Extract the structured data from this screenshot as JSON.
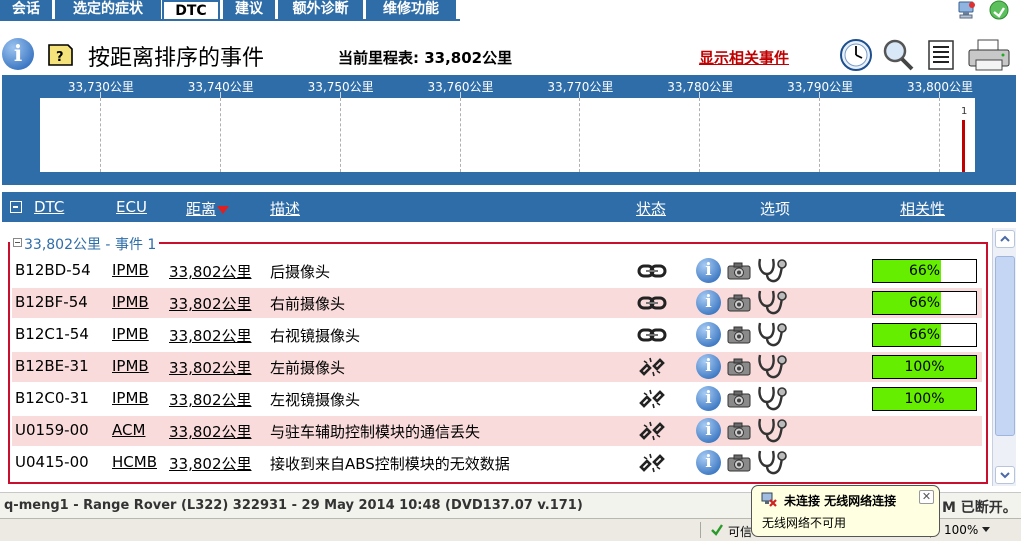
{
  "tabs": [
    {
      "label": "会话",
      "active": false
    },
    {
      "label": "选定的症状",
      "active": false
    },
    {
      "label": "DTC",
      "active": true
    },
    {
      "label": "建议",
      "active": false
    },
    {
      "label": "额外诊断",
      "active": false
    },
    {
      "label": "维修功能",
      "active": false
    }
  ],
  "header": {
    "title": "按距离排序的事件",
    "odometer": "当前里程表: 33,802公里",
    "show_related": "显示相关事件"
  },
  "timeline": {
    "labels": [
      "33,730公里",
      "33,740公里",
      "33,750公里",
      "33,760公里",
      "33,770公里",
      "33,780公里",
      "33,790公里",
      "33,800公里"
    ],
    "event_count_label": "1",
    "range": [
      33725,
      33803
    ],
    "event_at": 33802
  },
  "columns": {
    "dtc": "DTC",
    "ecu": "ECU",
    "distance": "距离",
    "description": "描述",
    "status": "状态",
    "options": "选项",
    "relevance": "相关性"
  },
  "group": {
    "legend": "33,802公里 - 事件 1"
  },
  "rows": [
    {
      "dtc": "B12BD-54",
      "ecu": "IPMB",
      "distance": "33,802公里",
      "description": "后摄像头",
      "status": "connected",
      "relevance": "66%",
      "relevance_value": 0.66
    },
    {
      "dtc": "B12BF-54",
      "ecu": "IPMB",
      "distance": "33,802公里",
      "description": "右前摄像头",
      "status": "connected",
      "relevance": "66%",
      "relevance_value": 0.66
    },
    {
      "dtc": "B12C1-54",
      "ecu": "IPMB",
      "distance": "33,802公里",
      "description": "右视镜摄像头",
      "status": "connected",
      "relevance": "66%",
      "relevance_value": 0.66
    },
    {
      "dtc": "B12BE-31",
      "ecu": "IPMB",
      "distance": "33,802公里",
      "description": "左前摄像头",
      "status": "broken",
      "relevance": "100%",
      "relevance_value": 1.0
    },
    {
      "dtc": "B12C0-31",
      "ecu": "IPMB",
      "distance": "33,802公里",
      "description": "左视镜摄像头",
      "status": "broken",
      "relevance": "100%",
      "relevance_value": 1.0
    },
    {
      "dtc": "U0159-00",
      "ecu": "ACM",
      "distance": "33,802公里",
      "description": "与驻车辅助控制模块的通信丢失",
      "status": "broken",
      "relevance": "",
      "relevance_value": null
    },
    {
      "dtc": "U0415-00",
      "ecu": "HCMB",
      "distance": "33,802公里",
      "description": "接收到来自ABS控制模块的无效数据",
      "status": "broken",
      "relevance": "",
      "relevance_value": null
    }
  ],
  "status_bar": {
    "session": "q-meng1 - Range Rover (L322) 322931 - 29 May 2014 10:48 (DVD137.07 v.171)",
    "right": "M 已断开。"
  },
  "ie_status": {
    "trusted": "可信",
    "zoom": "100%"
  },
  "balloon": {
    "title": "未连接  无线网络连接",
    "body": "无线网络不可用",
    "close": "✕"
  },
  "colors": {
    "header_blue": "#2f6da8",
    "alt_row": "#fadbdb",
    "group_border": "#c8102e",
    "relevance_fill": "#66ee00",
    "link_red": "#c00000"
  }
}
